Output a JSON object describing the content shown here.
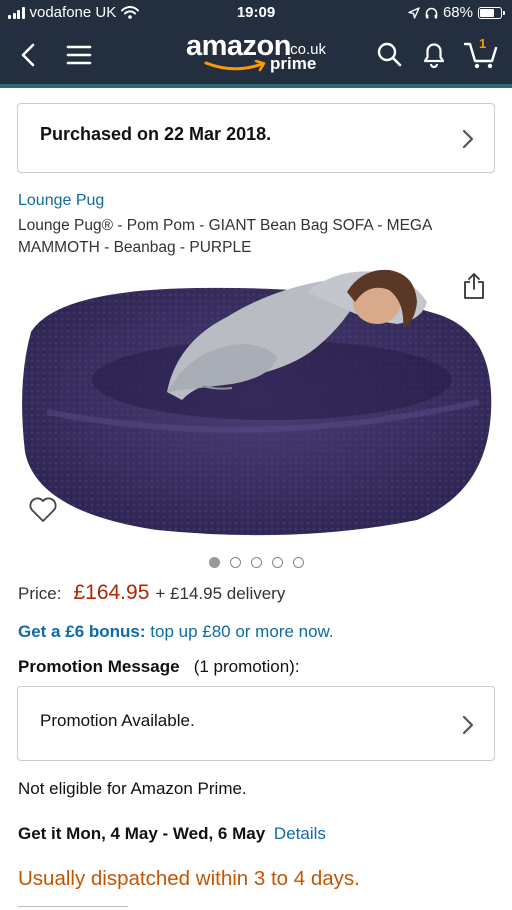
{
  "status_bar": {
    "carrier": "vodafone UK",
    "time": "19:09",
    "battery": "68%",
    "battery_level": 0.68
  },
  "nav": {
    "logo_main": "amazon",
    "logo_tld": ".co.uk",
    "logo_sub": "prime",
    "cart_count": "1",
    "icons": [
      "back-icon",
      "menu-icon",
      "search-icon",
      "bell-icon",
      "cart-icon"
    ]
  },
  "purchased": {
    "text": "Purchased on 22 Mar 2018."
  },
  "product": {
    "brand": "Lounge Pug",
    "title": "Lounge Pug® - Pom Pom - GIANT Bean Bag SOFA - MEGA MAMMOTH - Beanbag - PURPLE",
    "image_count": 5,
    "active_image": 0,
    "colors": {
      "beanbag": "#3b2f63",
      "link": "#0f6ba5",
      "price": "#b12704",
      "dispatch": "#c45500"
    }
  },
  "price": {
    "label": "Price:",
    "amount": "£164.95",
    "delivery": "+ £14.95 delivery"
  },
  "bonus": {
    "bold": "Get a £6 bonus:",
    "rest": "top up £80 or more now."
  },
  "promotion": {
    "heading": "Promotion Message",
    "count": "(1 promotion):",
    "card_text": "Promotion Available."
  },
  "eligibility": "Not eligible for Amazon Prime.",
  "delivery": {
    "text": "Get it Mon, 4 May - Wed, 6 May",
    "link": "Details"
  },
  "dispatch": "Usually dispatched within 3 to 4 days."
}
